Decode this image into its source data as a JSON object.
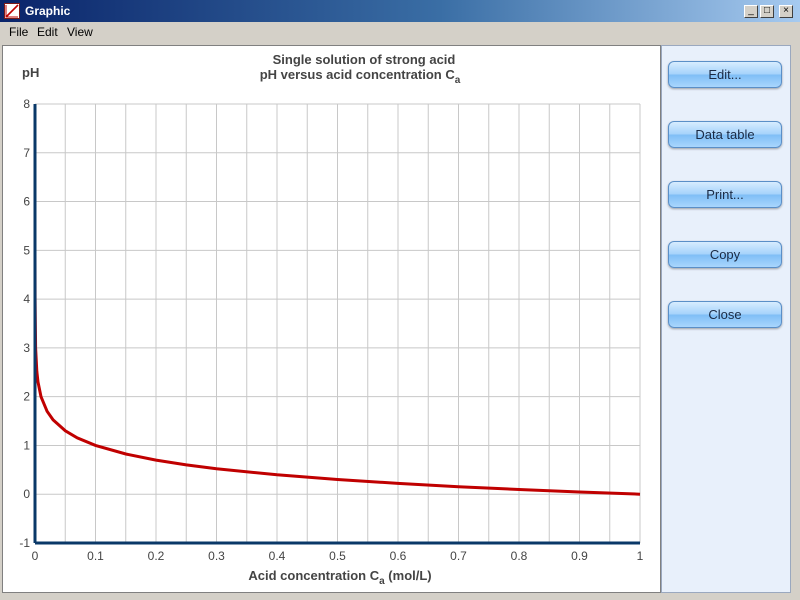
{
  "window": {
    "title": "Graphic"
  },
  "menu": [
    {
      "label": "File"
    },
    {
      "label": "Edit"
    },
    {
      "label": "View"
    }
  ],
  "buttons": {
    "edit": "Edit...",
    "data_table": "Data table",
    "print": "Print...",
    "copy": "Copy",
    "close": "Close"
  },
  "chart_data": {
    "type": "line",
    "title": "Single solution of strong acid",
    "subtitle": "pH versus acid concentration C",
    "subtitle_sub": "a",
    "ylabel": "pH",
    "xlabel_main": "Acid concentration C",
    "xlabel_sub": "a",
    "xlabel_tail": " (mol/L)",
    "xlim": [
      0,
      1
    ],
    "ylim": [
      -1,
      8
    ],
    "x_ticks": [
      "0",
      "0.1",
      "0.2",
      "0.3",
      "0.4",
      "0.5",
      "0.6",
      "0.7",
      "0.8",
      "0.9",
      "1"
    ],
    "y_ticks": [
      "-1",
      "0",
      "1",
      "2",
      "3",
      "4",
      "5",
      "6",
      "7",
      "8"
    ],
    "grid": true,
    "line_color": "#c00000",
    "series": [
      {
        "x": [
          0,
          1e-07,
          1e-06,
          1e-05,
          0.0001,
          0.001,
          0.003,
          0.005,
          0.01,
          0.02,
          0.03,
          0.05,
          0.07,
          0.1,
          0.15,
          0.2,
          0.25,
          0.3,
          0.4,
          0.5,
          0.6,
          0.7,
          0.8,
          0.9,
          1.0
        ],
        "y": [
          7.0,
          6.79,
          5.996,
          5.0,
          4.0,
          3.0,
          2.523,
          2.301,
          2.0,
          1.699,
          1.523,
          1.301,
          1.155,
          1.0,
          0.824,
          0.699,
          0.602,
          0.523,
          0.398,
          0.301,
          0.222,
          0.155,
          0.097,
          0.046,
          0.0
        ]
      }
    ]
  }
}
